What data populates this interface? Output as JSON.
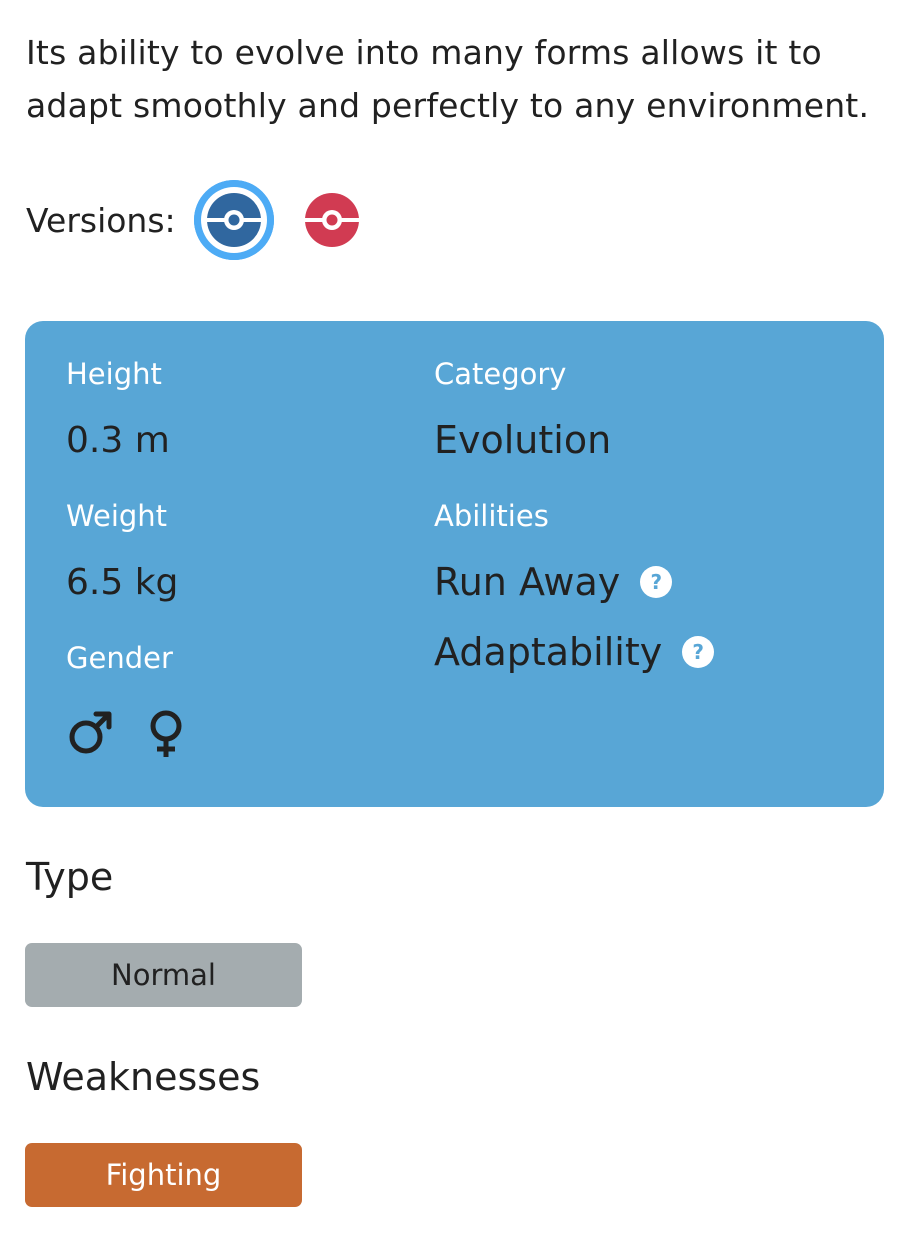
{
  "description": "Its ability to evolve into many forms allows it to adapt smoothly and perfectly to any environment.",
  "versions": {
    "label": "Versions:",
    "items": [
      {
        "name": "pokeball-blue-icon",
        "color": "#30679f",
        "selected": true
      },
      {
        "name": "pokeball-red-icon",
        "color": "#d13b52",
        "selected": false
      }
    ]
  },
  "info": {
    "height_label": "Height",
    "height_value": "0.3 m",
    "weight_label": "Weight",
    "weight_value": "6.5 kg",
    "gender_label": "Gender",
    "category_label": "Category",
    "category_value": "Evolution",
    "abilities_label": "Abilities",
    "abilities": [
      "Run Away",
      "Adaptability"
    ],
    "help_symbol": "?",
    "card_color": "#58a6d6"
  },
  "type": {
    "title": "Type",
    "items": [
      {
        "label": "Normal",
        "color": "#a4acaf"
      }
    ]
  },
  "weaknesses": {
    "title": "Weaknesses",
    "items": [
      {
        "label": "Fighting",
        "color": "#c76a31"
      }
    ]
  }
}
